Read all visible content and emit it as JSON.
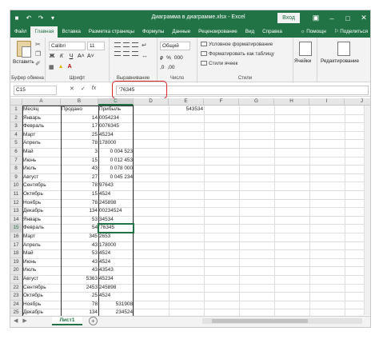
{
  "window": {
    "title": "Диаграмма в диаграмме.xlsx - Excel",
    "signin": "Вход",
    "qat_icons": [
      "save-icon",
      "undo-icon",
      "redo-icon",
      "customize-icon"
    ],
    "controls": [
      "ribbon-display-icon",
      "minimize-icon",
      "maximize-icon",
      "close-icon"
    ]
  },
  "tabs": [
    "Файл",
    "Главная",
    "Вставка",
    "Разметка страницы",
    "Формулы",
    "Данные",
    "Рецензирование",
    "Вид",
    "Справка"
  ],
  "tabs_right": [
    "Помощн",
    "Поделиться"
  ],
  "tabs_right_icons": [
    "lightbulb-icon",
    "share-icon"
  ],
  "active_tab": "Главная",
  "ribbon": {
    "paste_label": "Вставить",
    "font_name": "Calibri",
    "font_size": "11",
    "format_buttons": [
      "Ж",
      "К",
      "Ч"
    ],
    "number_format": "Общий",
    "number_row": [
      "%",
      "000",
      ",0",
      ",00"
    ],
    "currency": "₽",
    "styles": [
      "Условное форматирование",
      "Форматировать как таблицу",
      "Стили ячеек"
    ],
    "cells_label": "Ячейки",
    "editing_label": "Редактирование",
    "groups": {
      "clipboard": "Буфер обмена",
      "font": "Шрифт",
      "alignment": "Выравнивание",
      "number": "Число",
      "styles": "Стили"
    }
  },
  "formula_bar": {
    "name_box": "C15",
    "value": "'76345",
    "icons": [
      "cancel-icon",
      "enter-icon",
      "function-icon"
    ],
    "fx": "fx"
  },
  "columns": [
    "A",
    "B",
    "C",
    "D",
    "E",
    "F",
    "G",
    "H",
    "I",
    "J",
    "K"
  ],
  "selected_column": "C",
  "selected_row": 15,
  "rows": [
    {
      "n": 1,
      "a": "Месяц",
      "b": "Продано",
      "c": "Прибыль",
      "c_right": false
    },
    {
      "n": 2,
      "a": "Январь",
      "b": "14",
      "c": "0054234",
      "c_right": false
    },
    {
      "n": 3,
      "a": "Февраль",
      "b": "17",
      "c": "0076345",
      "c_right": false
    },
    {
      "n": 4,
      "a": "Март",
      "b": "25",
      "c": "45234",
      "c_right": false
    },
    {
      "n": 5,
      "a": "Апрель",
      "b": "78",
      "c": "178000",
      "c_right": false
    },
    {
      "n": 6,
      "a": "Май",
      "b": "3",
      "c": "0 004 523",
      "c_right": true
    },
    {
      "n": 7,
      "a": "Июнь",
      "b": "15",
      "c": "0 012 453",
      "c_right": true
    },
    {
      "n": 8,
      "a": "Июль",
      "b": "43",
      "c": "0 078 000",
      "c_right": true
    },
    {
      "n": 9,
      "a": "Август",
      "b": "27",
      "c": "0 045 234",
      "c_right": true
    },
    {
      "n": 10,
      "a": "Сентябрь",
      "b": "78",
      "c": "97643",
      "c_right": false
    },
    {
      "n": 11,
      "a": "Октябрь",
      "b": "15",
      "c": "4524",
      "c_right": false
    },
    {
      "n": 12,
      "a": "Ноябрь",
      "b": "78",
      "c": "245898",
      "c_right": false
    },
    {
      "n": 13,
      "a": "Декабрь",
      "b": "134",
      "c": "00234524",
      "c_right": false
    },
    {
      "n": 14,
      "a": "Январь",
      "b": "53",
      "c": "34534",
      "c_right": false
    },
    {
      "n": 15,
      "a": "Февраль",
      "b": "54",
      "c": "'76345",
      "c_right": false
    },
    {
      "n": 16,
      "a": "Март",
      "b": "345",
      "c": "2653",
      "c_right": false
    },
    {
      "n": 17,
      "a": "Апрель",
      "b": "43",
      "c": "178000",
      "c_right": false
    },
    {
      "n": 18,
      "a": "Май",
      "b": "53",
      "c": "4524",
      "c_right": false
    },
    {
      "n": 19,
      "a": "Июнь",
      "b": "43",
      "c": "4524",
      "c_right": false
    },
    {
      "n": 20,
      "a": "Июль",
      "b": "43",
      "c": "43543",
      "c_right": false
    },
    {
      "n": 21,
      "a": "Август",
      "b": "5363",
      "c": "45234",
      "c_right": false
    },
    {
      "n": 22,
      "a": "Сентябрь",
      "b": "2453",
      "c": "245898",
      "c_right": false
    },
    {
      "n": 23,
      "a": "Октябрь",
      "b": "25",
      "c": "4524",
      "c_right": false
    },
    {
      "n": 24,
      "a": "Ноябрь",
      "b": "78",
      "c": "531908",
      "c_right": true
    },
    {
      "n": 25,
      "a": "Декабрь",
      "b": "134",
      "c": "234524",
      "c_right": true
    }
  ],
  "extra_cell": {
    "row": 1,
    "col": "E",
    "value": "543534"
  },
  "sheet_tab": "Лист1",
  "add_sheet": "+",
  "sheet_nav": [
    "◀",
    "▶"
  ]
}
